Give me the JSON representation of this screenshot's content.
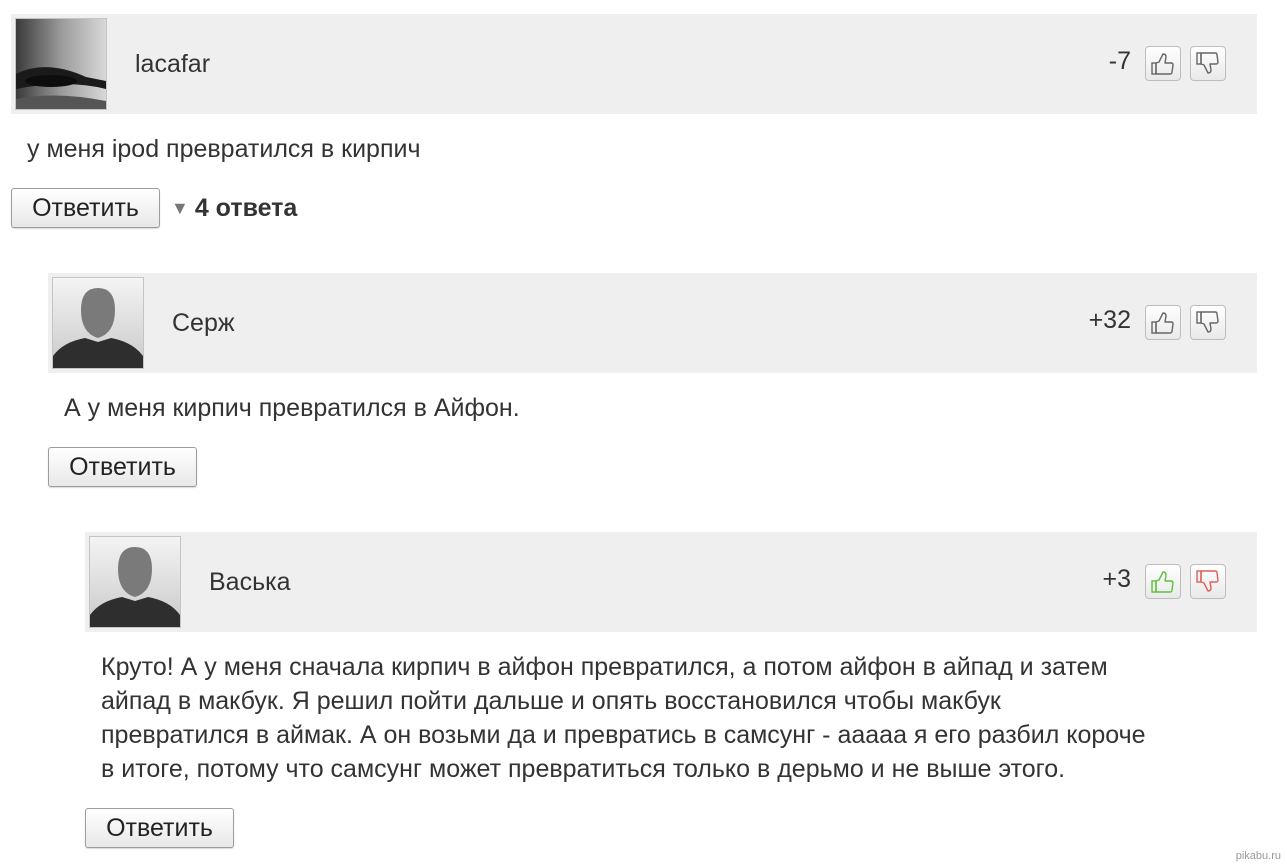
{
  "comments": [
    {
      "username": "lacafar",
      "score": "-7",
      "text": "у меня ipod превратился в кирпич",
      "reply_label": "Ответить",
      "replies_label": "4 ответа",
      "avatar": "eye-photo",
      "vote_state": "neutral"
    },
    {
      "username": "Серж",
      "score": "+32",
      "text": "А у меня кирпич превратился в Айфон.",
      "reply_label": "Ответить",
      "avatar": "default-silhouette",
      "vote_state": "neutral"
    },
    {
      "username": "Васька",
      "score": "+3",
      "text": "Круто! А у меня сначала кирпич в айфон превратился, а потом айфон в айпад и затем\nайпад в макбук. Я решил пойти дальше и опять восстановился чтобы макбук\nпревратился в аймак. А он возьми да и превратись в самсунг - ааааа я его разбил короче\nв итоге, потому что самсунг может превратиться только в дерьмо и не выше этого.",
      "reply_label": "Ответить",
      "avatar": "default-silhouette",
      "vote_state": "colored"
    }
  ],
  "icons": {
    "thumb_up": "thumbs-up-icon",
    "thumb_down": "thumbs-down-icon",
    "replies_toggle": "triangle-down-icon"
  },
  "colors": {
    "header_bg": "#efefef",
    "thumb_up_active": "#5fbf3f",
    "thumb_down_active": "#e0605a",
    "thumb_neutral": "#666666"
  },
  "watermark": "pikabu.ru"
}
